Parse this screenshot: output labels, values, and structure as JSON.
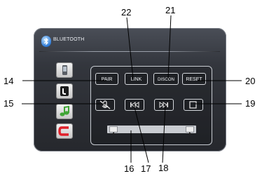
{
  "header": {
    "title": "BLUETOOTH"
  },
  "buttons": {
    "pair": "PAIR",
    "link": "LINK",
    "discon": "DISCON",
    "reset": "RESET"
  },
  "sidebar": [
    {
      "icon": "mobile-phone-icon"
    },
    {
      "icon": "phone-call-icon"
    },
    {
      "icon": "music-note-icon"
    },
    {
      "icon": "back-return-icon"
    }
  ],
  "controls": [
    {
      "icon": "mute-mic-icon"
    },
    {
      "icon": "previous-track-icon"
    },
    {
      "icon": "next-track-icon"
    },
    {
      "icon": "stop-icon"
    }
  ],
  "callouts": {
    "c14": "14",
    "c15": "15",
    "c16": "16",
    "c17": "17",
    "c18": "18",
    "c19": "19",
    "c20": "20",
    "c21": "21",
    "c22": "22"
  },
  "colors": {
    "screen": "#2e3036",
    "button_border": "#d4d7dc",
    "red_icon": "#e0202a",
    "green_icon": "#3fa535"
  }
}
